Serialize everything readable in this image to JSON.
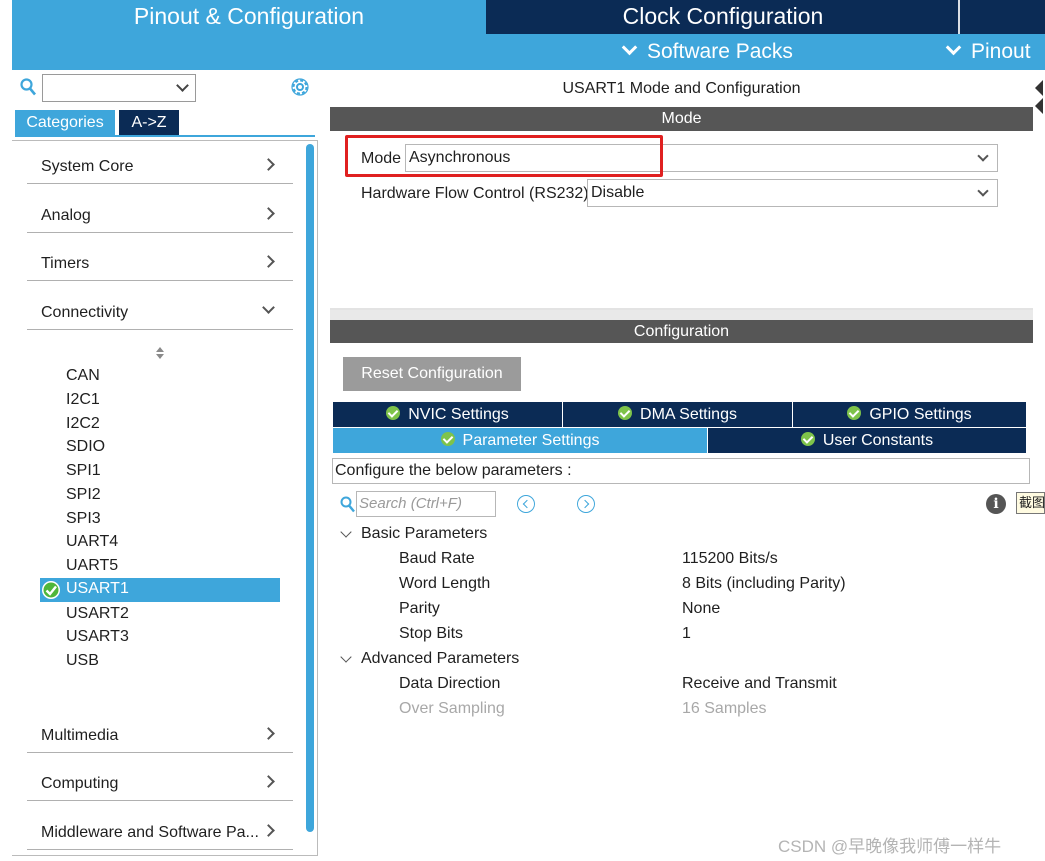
{
  "top_tabs": {
    "pinout": "Pinout & Configuration",
    "clock": "Clock Configuration"
  },
  "sub_menu": {
    "software_packs": "Software Packs",
    "pinout": "Pinout"
  },
  "left": {
    "tabs": {
      "categories": "Categories",
      "az": "A->Z"
    },
    "categories": {
      "system_core": "System Core",
      "analog": "Analog",
      "timers": "Timers",
      "connectivity": "Connectivity",
      "multimedia": "Multimedia",
      "computing": "Computing",
      "middleware": "Middleware and Software Pa..."
    },
    "peripherals": [
      "CAN",
      "I2C1",
      "I2C2",
      "SDIO",
      "SPI1",
      "SPI2",
      "SPI3",
      "UART4",
      "UART5",
      "USART1",
      "USART2",
      "USART3",
      "USB"
    ],
    "selected_peripheral": "USART1"
  },
  "right": {
    "title": "USART1 Mode and Configuration",
    "mode_header": "Mode",
    "mode_label": "Mode",
    "mode_value": "Asynchronous",
    "flow_label": "Hardware Flow Control (RS232)",
    "flow_value": "Disable",
    "config_header": "Configuration",
    "reset_button": "Reset Configuration",
    "tabs": {
      "nvic": "NVIC Settings",
      "dma": "DMA Settings",
      "gpio": "GPIO Settings",
      "param": "Parameter Settings",
      "user": "User Constants"
    },
    "description": "Configure the below parameters :",
    "search_placeholder": "Search (Ctrl+F)",
    "info_glyph": "i",
    "groups": {
      "basic": "Basic Parameters",
      "advanced": "Advanced Parameters"
    },
    "basic_params": [
      {
        "name": "Baud Rate",
        "value": "115200 Bits/s"
      },
      {
        "name": "Word Length",
        "value": "8 Bits (including Parity)"
      },
      {
        "name": "Parity",
        "value": "None"
      },
      {
        "name": "Stop Bits",
        "value": "1"
      }
    ],
    "advanced_params": [
      {
        "name": "Data Direction",
        "value": "Receive and Transmit"
      },
      {
        "name": "Over Sampling",
        "value": "16 Samples"
      }
    ]
  },
  "tooltip": "截图",
  "watermark": "CSDN @早晚像我师傅一样牛",
  "colors": {
    "accent": "#3ea6db",
    "navy": "#0b2b55",
    "bar_gray": "#565656",
    "highlight": "#e02020"
  }
}
